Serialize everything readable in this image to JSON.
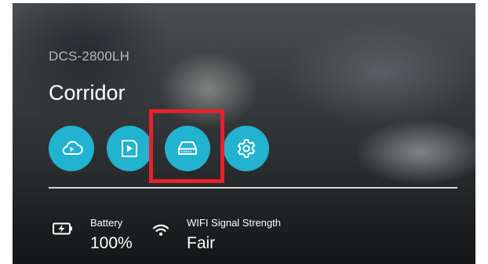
{
  "device": {
    "model": "DCS-2800LH",
    "camera_name": "Corridor"
  },
  "actions": [
    {
      "id": "cloud-recordings",
      "icon": "cloud-play-icon"
    },
    {
      "id": "video-playback",
      "icon": "video-play-icon"
    },
    {
      "id": "local-storage",
      "icon": "hard-drive-icon",
      "highlighted": true
    },
    {
      "id": "settings",
      "icon": "gear-icon"
    }
  ],
  "status": {
    "battery": {
      "label": "Battery",
      "value": "100%",
      "icon": "battery-charging-icon"
    },
    "wifi": {
      "label": "WIFI Signal Strength",
      "value": "Fair",
      "icon": "wifi-icon"
    }
  },
  "colors": {
    "accent": "#21b3cf",
    "highlight": "#e8212b",
    "text": "#ffffff"
  }
}
